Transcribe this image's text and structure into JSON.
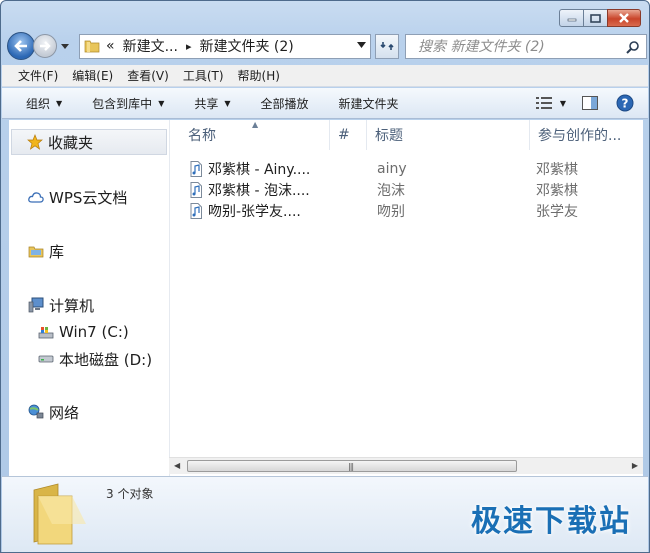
{
  "window": {
    "caption": {
      "minimize": "minimize-icon",
      "maximize": "maximize-icon",
      "close": "close-icon"
    }
  },
  "nav": {
    "breadcrumb": {
      "overflow": "«",
      "item1": "新建文...",
      "item2": "新建文件夹 (2)"
    },
    "search_placeholder": "搜索 新建文件夹 (2)"
  },
  "menu": {
    "file": "文件(F)",
    "edit": "编辑(E)",
    "view": "查看(V)",
    "tools": "工具(T)",
    "help": "帮助(H)"
  },
  "toolbar": {
    "organize": "组织",
    "include_library": "包含到库中",
    "share": "共享",
    "play_all": "全部播放",
    "new_folder": "新建文件夹"
  },
  "sidebar": {
    "favorites": "收藏夹",
    "wps": "WPS云文档",
    "libraries": "库",
    "computer": "计算机",
    "drive_c": "Win7 (C:)",
    "drive_d": "本地磁盘 (D:)",
    "network": "网络"
  },
  "columns": {
    "name": "名称",
    "number": "#",
    "title": "标题",
    "artist": "参与创作的..."
  },
  "files": [
    {
      "name": "邓紫棋 - Ainy....",
      "title": "ainy",
      "artist": "邓紫棋"
    },
    {
      "name": "邓紫棋 - 泡沫....",
      "title": "泡沫",
      "artist": "邓紫棋"
    },
    {
      "name": "吻别-张学友....",
      "title": "吻别",
      "artist": "张学友"
    }
  ],
  "status": {
    "count": "3 个对象"
  },
  "watermark": "极速下载站",
  "colors": {
    "accent": "#2b67b4",
    "watermark": "#1a6fb5",
    "toolbar_bg": "#dce7f4"
  }
}
